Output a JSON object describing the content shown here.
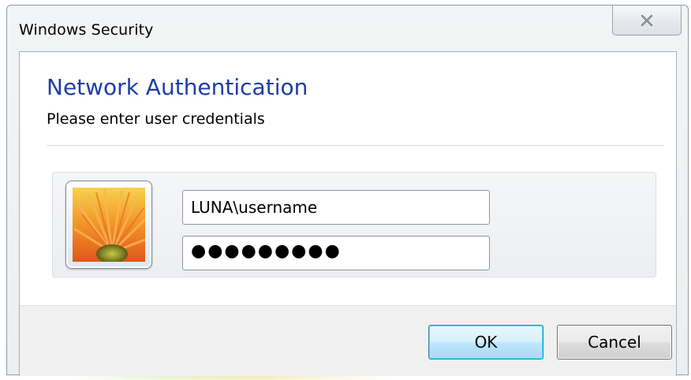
{
  "window": {
    "title": "Windows Security"
  },
  "dialog": {
    "heading": "Network Authentication",
    "subheading": "Please enter user credentials"
  },
  "credentials": {
    "avatar_icon": "flower-user-tile-icon",
    "username_value": "LUNA\\username",
    "password_value": "●●●●●●●●●"
  },
  "buttons": {
    "ok_label": "OK",
    "cancel_label": "Cancel"
  },
  "icons": {
    "close": "close-icon"
  },
  "colors": {
    "heading": "#1e3da6",
    "ok_button": "#bee6fd",
    "footer": "#f0f0f0"
  }
}
